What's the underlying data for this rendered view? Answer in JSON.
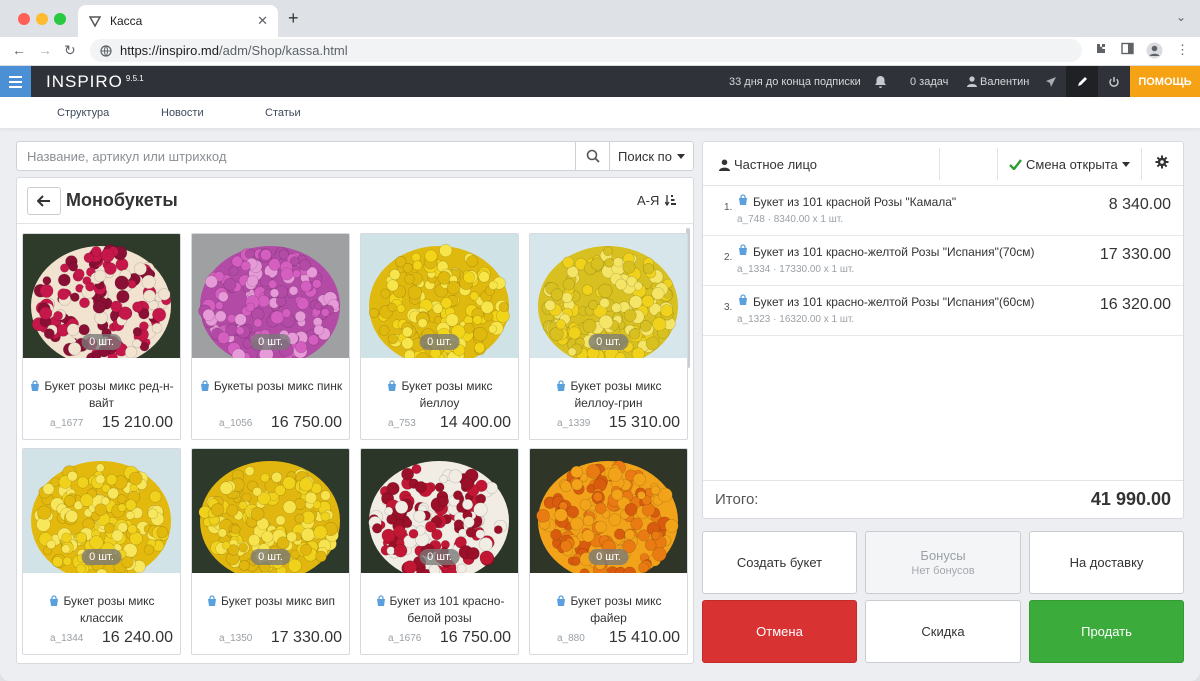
{
  "browser": {
    "tab_title": "Касса",
    "url_host": "https://inspiro.md",
    "url_path": "/adm/Shop/kassa.html"
  },
  "app": {
    "brand": "INSPIRO",
    "version": "9.5.1",
    "subscription": "33 дня до конца подписки",
    "tasks": "0 задач",
    "user": "Валентин",
    "help": "ПОМОЩЬ"
  },
  "nav": [
    "Структура",
    "Новости",
    "Статьи"
  ],
  "search": {
    "placeholder": "Название, артикул или штрихкод",
    "by_label": "Поиск по"
  },
  "catalog": {
    "title": "Монобукеты",
    "sort_label": "А-Я",
    "products": [
      {
        "name": "Букет розы микс ред-н-вайт",
        "sku": "a_1677",
        "price": "15 210.00",
        "qty": "0 шт.",
        "colors": [
          "#c6174a",
          "#f2e3d1",
          "#8a0f34"
        ],
        "bg": "#2e3a2a"
      },
      {
        "name": "Букеты розы микс пинк",
        "sku": "a_1056",
        "price": "16 750.00",
        "qty": "0 шт.",
        "colors": [
          "#d45fc0",
          "#b24aa6",
          "#e79ad8"
        ],
        "bg": "#9ea0a2"
      },
      {
        "name": "Букет розы микс йеллоу",
        "sku": "a_753",
        "price": "14 400.00",
        "qty": "0 шт.",
        "colors": [
          "#f2d418",
          "#e0b90f",
          "#f7e54a"
        ],
        "bg": "#cfe2e6"
      },
      {
        "name": "Букет розы микс йеллоу-грин",
        "sku": "a_1339",
        "price": "15 310.00",
        "qty": "0 шт.",
        "colors": [
          "#f0d21c",
          "#d7c020",
          "#f5e566"
        ],
        "bg": "#d7e6ea"
      },
      {
        "name": "Букет розы микс классик",
        "sku": "a_1344",
        "price": "16 240.00",
        "qty": "0 шт.",
        "colors": [
          "#f0d21c",
          "#e3b90e",
          "#f8e65c"
        ],
        "bg": "#d1e3e7"
      },
      {
        "name": "Букет розы микс вип",
        "sku": "a_1350",
        "price": "17 330.00",
        "qty": "0 шт.",
        "colors": [
          "#f0d21c",
          "#e0b60f",
          "#f7e34e"
        ],
        "bg": "#2d3a2b"
      },
      {
        "name": "Букет из 101 красно-белой розы",
        "sku": "a_1676",
        "price": "16 750.00",
        "qty": "0 шт.",
        "colors": [
          "#9a1028",
          "#f2ede4",
          "#c21734"
        ],
        "bg": "#2b3528"
      },
      {
        "name": "Букет розы микс файер",
        "sku": "a_880",
        "price": "15 410.00",
        "qty": "0 шт.",
        "colors": [
          "#ea7a12",
          "#f2a31a",
          "#d85b0e"
        ],
        "bg": "#2f3628"
      }
    ]
  },
  "cart": {
    "customer": "Частное лицо",
    "shift": "Смена открыта",
    "items": [
      {
        "num": "1.",
        "name": "Букет из 101 красной Розы \"Камала\"",
        "sub": "a_748 · 8340.00 x 1 шт.",
        "price": "8 340.00"
      },
      {
        "num": "2.",
        "name": "Букет из 101 красно-желтой Розы \"Испания\"(70см)",
        "sub": "a_1334 · 17330.00 x 1 шт.",
        "price": "17 330.00"
      },
      {
        "num": "3.",
        "name": "Букет из 101 красно-желтой Розы \"Испания\"(60см)",
        "sub": "a_1323 · 16320.00 x 1 шт.",
        "price": "16 320.00"
      }
    ],
    "total_label": "Итого:",
    "total": "41 990.00"
  },
  "actions": {
    "create": "Создать букет",
    "bonus": "Бонусы",
    "bonus_sub": "Нет бонусов",
    "delivery": "На доставку",
    "cancel": "Отмена",
    "discount": "Скидка",
    "sell": "Продать"
  },
  "colors": {
    "accent_blue": "#4b8fd4",
    "help_orange": "#f5a214",
    "cancel_red": "#d93232",
    "sell_green": "#3bab3c",
    "topbar": "#2f3238"
  }
}
